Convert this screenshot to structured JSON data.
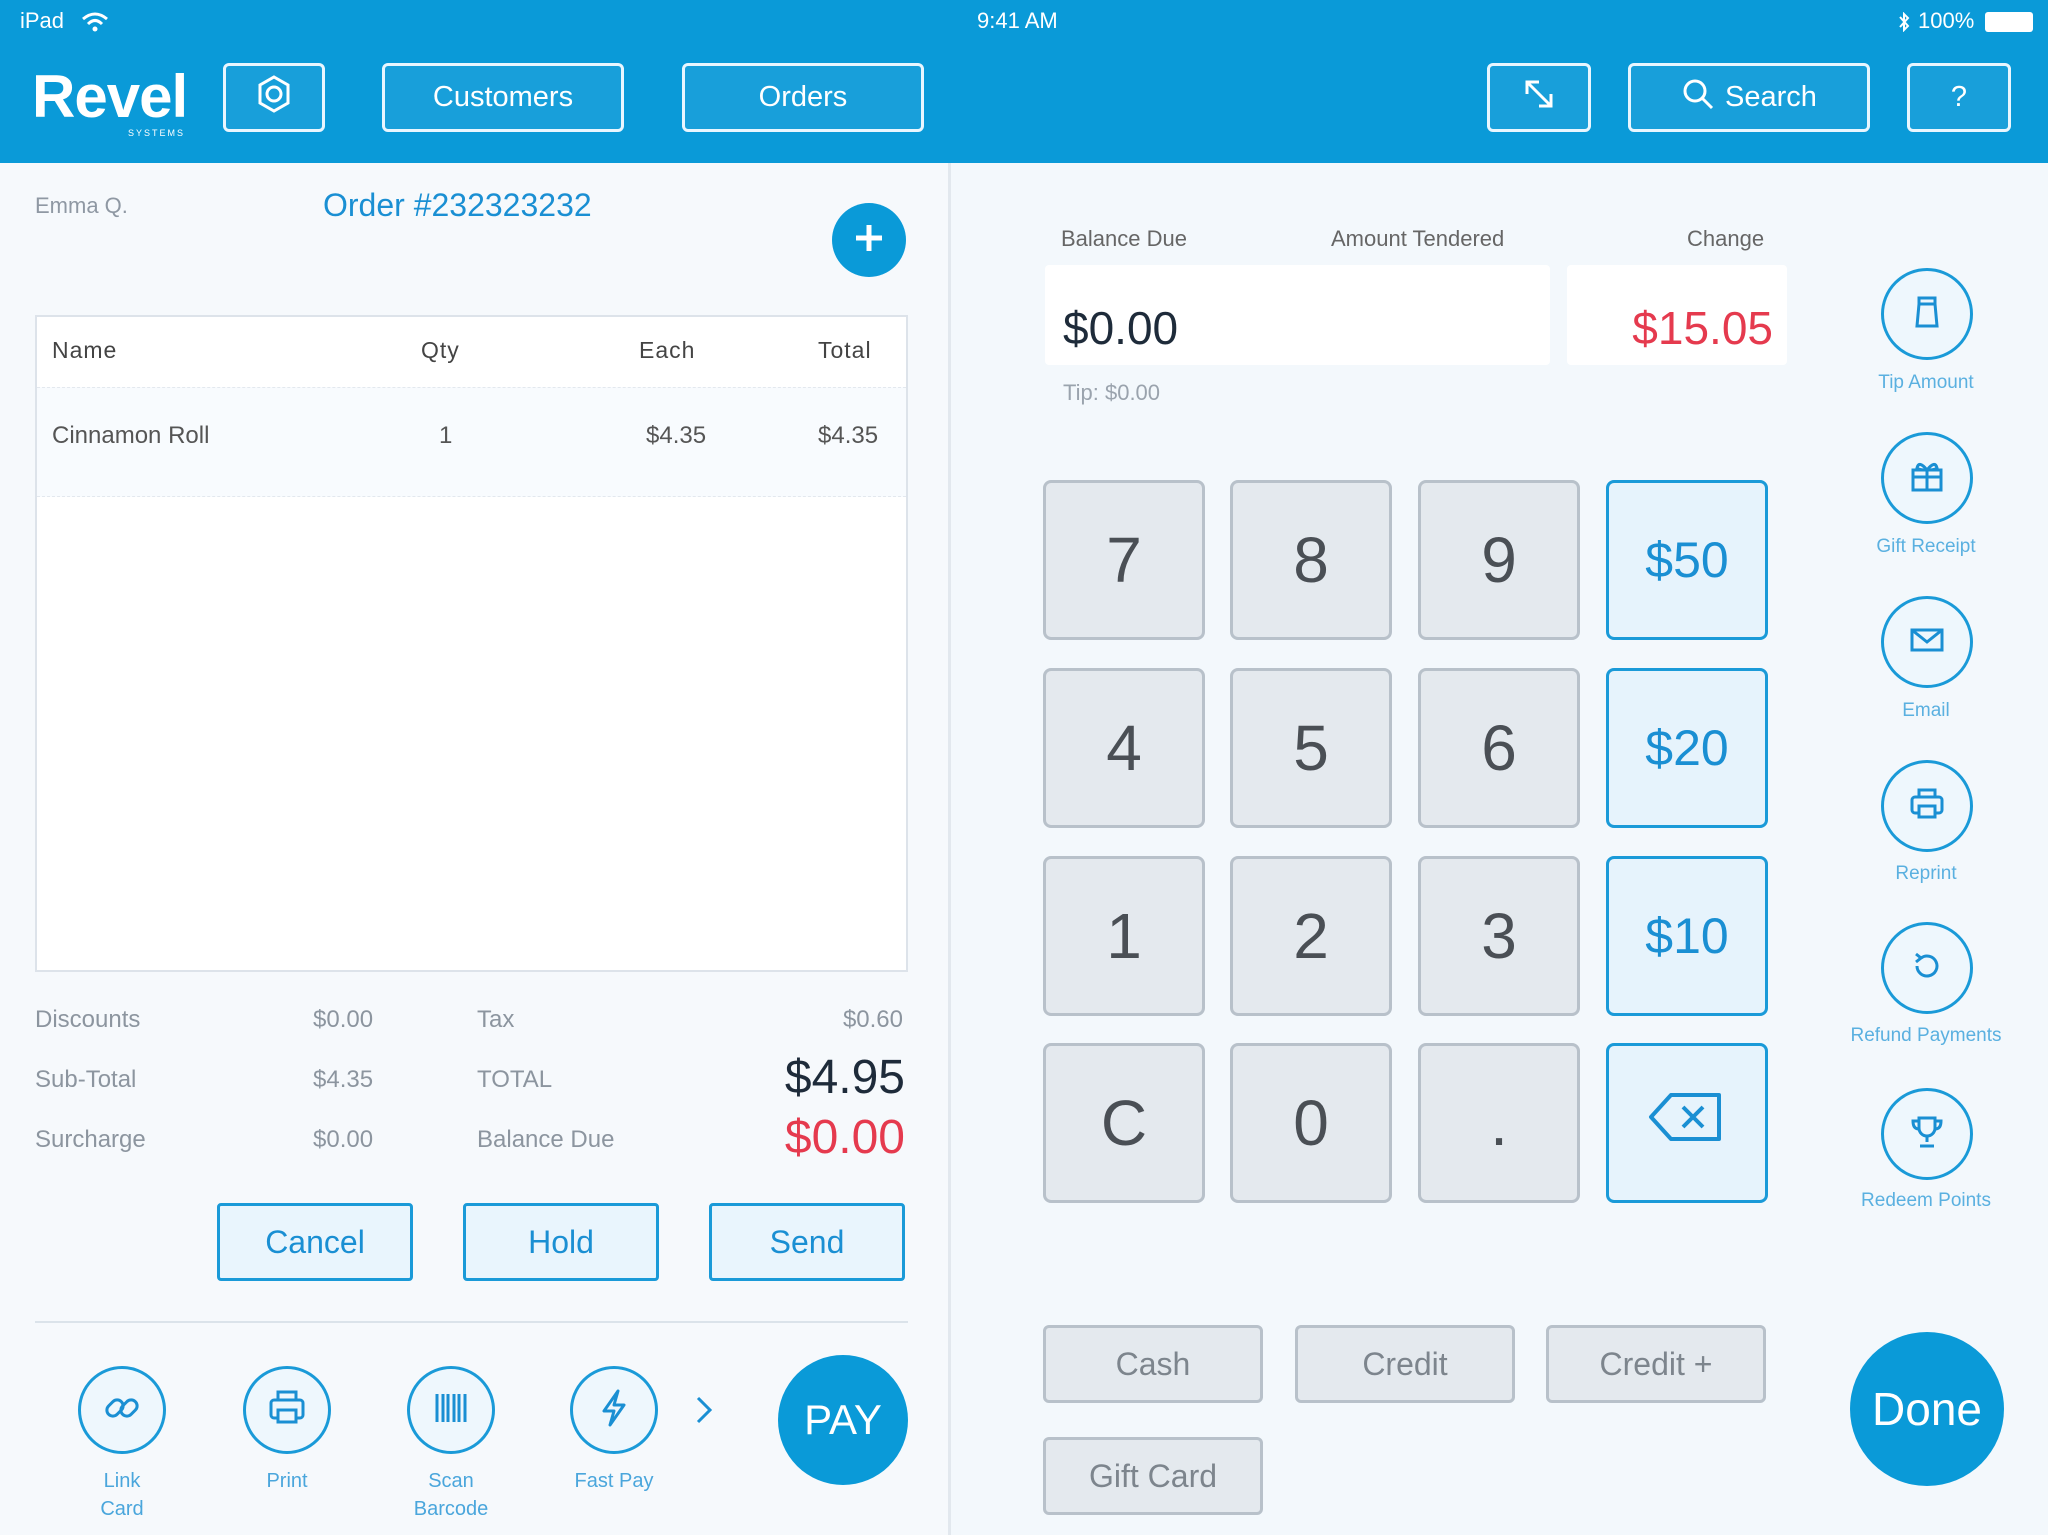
{
  "status_bar": {
    "device": "iPad",
    "time": "9:41 AM",
    "battery": "100%"
  },
  "header": {
    "logo": "Revel",
    "logo_sub": "SYSTEMS",
    "settings_icon": "gear-icon",
    "customers_label": "Customers",
    "orders_label": "Orders",
    "expand_icon": "expand-arrows-icon",
    "search_label": "Search",
    "help_label": "?"
  },
  "order": {
    "customer": "Emma Q.",
    "title": "Order #232323232",
    "add_icon": "plus-icon",
    "columns": [
      "Name",
      "Qty",
      "Each",
      "Total"
    ],
    "items": [
      {
        "name": "Cinnamon Roll",
        "qty": "1",
        "each": "$4.35",
        "total": "$4.35"
      }
    ]
  },
  "summary": {
    "discounts_label": "Discounts",
    "discounts": "$0.00",
    "subtotal_label": "Sub-Total",
    "subtotal": "$4.35",
    "surcharge_label": "Surcharge",
    "surcharge": "$0.00",
    "tax_label": "Tax",
    "tax": "$0.60",
    "total_label": "TOTAL",
    "total": "$4.95",
    "balance_label": "Balance Due",
    "balance": "$0.00"
  },
  "actions": {
    "cancel": "Cancel",
    "hold": "Hold",
    "send": "Send"
  },
  "bottom_tools": [
    {
      "label_line1": "Link",
      "label_line2": "Card",
      "icon": "link-icon"
    },
    {
      "label_line1": "Print",
      "label_line2": "",
      "icon": "printer-icon"
    },
    {
      "label_line1": "Scan",
      "label_line2": "Barcode",
      "icon": "barcode-icon"
    },
    {
      "label_line1": "Fast Pay",
      "label_line2": "",
      "icon": "lightning-icon"
    }
  ],
  "more_icon": "chevron-right-icon",
  "pay_label": "PAY",
  "payment": {
    "balance_due_label": "Balance Due",
    "amount_tendered_label": "Amount Tendered",
    "change_label": "Change",
    "tendered_value": "$0.00",
    "change_value": "$15.05",
    "tip_text": "Tip: $0.00"
  },
  "keypad": {
    "row1": [
      "7",
      "8",
      "9",
      "$50"
    ],
    "row2": [
      "4",
      "5",
      "6",
      "$20"
    ],
    "row3": [
      "1",
      "2",
      "3",
      "$10"
    ],
    "row4": [
      "C",
      "0",
      "."
    ],
    "backspace_icon": "backspace-icon"
  },
  "payment_methods": [
    "Cash",
    "Credit",
    "Credit +",
    "Gift Card"
  ],
  "side_actions": [
    {
      "label": "Tip Amount",
      "icon": "tip-jar-icon"
    },
    {
      "label": "Gift Receipt",
      "icon": "gift-icon"
    },
    {
      "label": "Email",
      "icon": "envelope-icon"
    },
    {
      "label": "Reprint",
      "icon": "printer-icon"
    },
    {
      "label": "Refund Payments",
      "icon": "refund-icon"
    },
    {
      "label": "Redeem Points",
      "icon": "trophy-icon"
    }
  ],
  "done_label": "Done"
}
